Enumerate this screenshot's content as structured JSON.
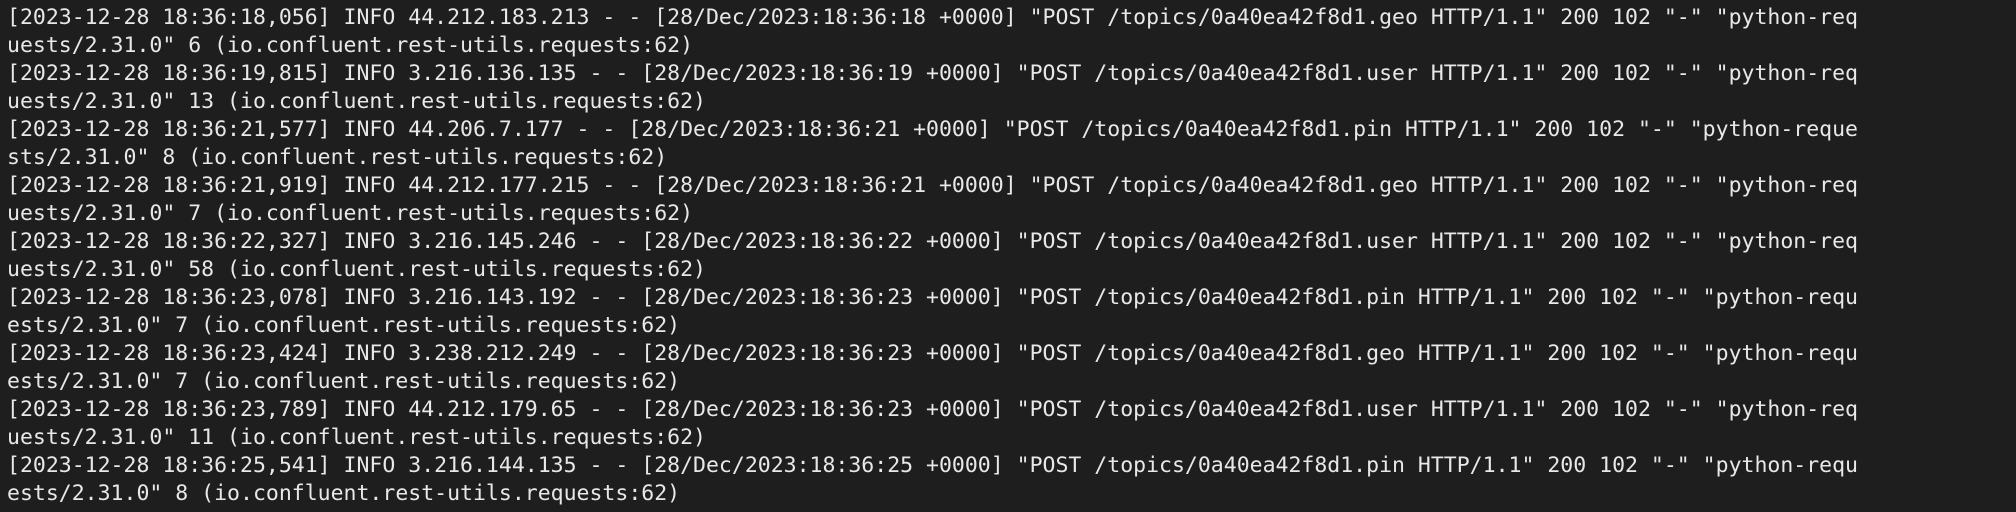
{
  "terminal": {
    "background": "#1e1e1e",
    "foreground": "#e8e8e8",
    "lines": [
      "[2023-12-28 18:36:18,056] INFO 44.212.183.213 - - [28/Dec/2023:18:36:18 +0000] \"POST /topics/0a40ea42f8d1.geo HTTP/1.1\" 200 102 \"-\" \"python-req",
      "uests/2.31.0\" 6 (io.confluent.rest-utils.requests:62)",
      "[2023-12-28 18:36:19,815] INFO 3.216.136.135 - - [28/Dec/2023:18:36:19 +0000] \"POST /topics/0a40ea42f8d1.user HTTP/1.1\" 200 102 \"-\" \"python-req",
      "uests/2.31.0\" 13 (io.confluent.rest-utils.requests:62)",
      "[2023-12-28 18:36:21,577] INFO 44.206.7.177 - - [28/Dec/2023:18:36:21 +0000] \"POST /topics/0a40ea42f8d1.pin HTTP/1.1\" 200 102 \"-\" \"python-reque",
      "sts/2.31.0\" 8 (io.confluent.rest-utils.requests:62)",
      "[2023-12-28 18:36:21,919] INFO 44.212.177.215 - - [28/Dec/2023:18:36:21 +0000] \"POST /topics/0a40ea42f8d1.geo HTTP/1.1\" 200 102 \"-\" \"python-req",
      "uests/2.31.0\" 7 (io.confluent.rest-utils.requests:62)",
      "[2023-12-28 18:36:22,327] INFO 3.216.145.246 - - [28/Dec/2023:18:36:22 +0000] \"POST /topics/0a40ea42f8d1.user HTTP/1.1\" 200 102 \"-\" \"python-req",
      "uests/2.31.0\" 58 (io.confluent.rest-utils.requests:62)",
      "[2023-12-28 18:36:23,078] INFO 3.216.143.192 - - [28/Dec/2023:18:36:23 +0000] \"POST /topics/0a40ea42f8d1.pin HTTP/1.1\" 200 102 \"-\" \"python-requ",
      "ests/2.31.0\" 7 (io.confluent.rest-utils.requests:62)",
      "[2023-12-28 18:36:23,424] INFO 3.238.212.249 - - [28/Dec/2023:18:36:23 +0000] \"POST /topics/0a40ea42f8d1.geo HTTP/1.1\" 200 102 \"-\" \"python-requ",
      "ests/2.31.0\" 7 (io.confluent.rest-utils.requests:62)",
      "[2023-12-28 18:36:23,789] INFO 44.212.179.65 - - [28/Dec/2023:18:36:23 +0000] \"POST /topics/0a40ea42f8d1.user HTTP/1.1\" 200 102 \"-\" \"python-req",
      "uests/2.31.0\" 11 (io.confluent.rest-utils.requests:62)",
      "[2023-12-28 18:36:25,541] INFO 3.216.144.135 - - [28/Dec/2023:18:36:25 +0000] \"POST /topics/0a40ea42f8d1.pin HTTP/1.1\" 200 102 \"-\" \"python-requ",
      "ests/2.31.0\" 8 (io.confluent.rest-utils.requests:62)"
    ]
  }
}
